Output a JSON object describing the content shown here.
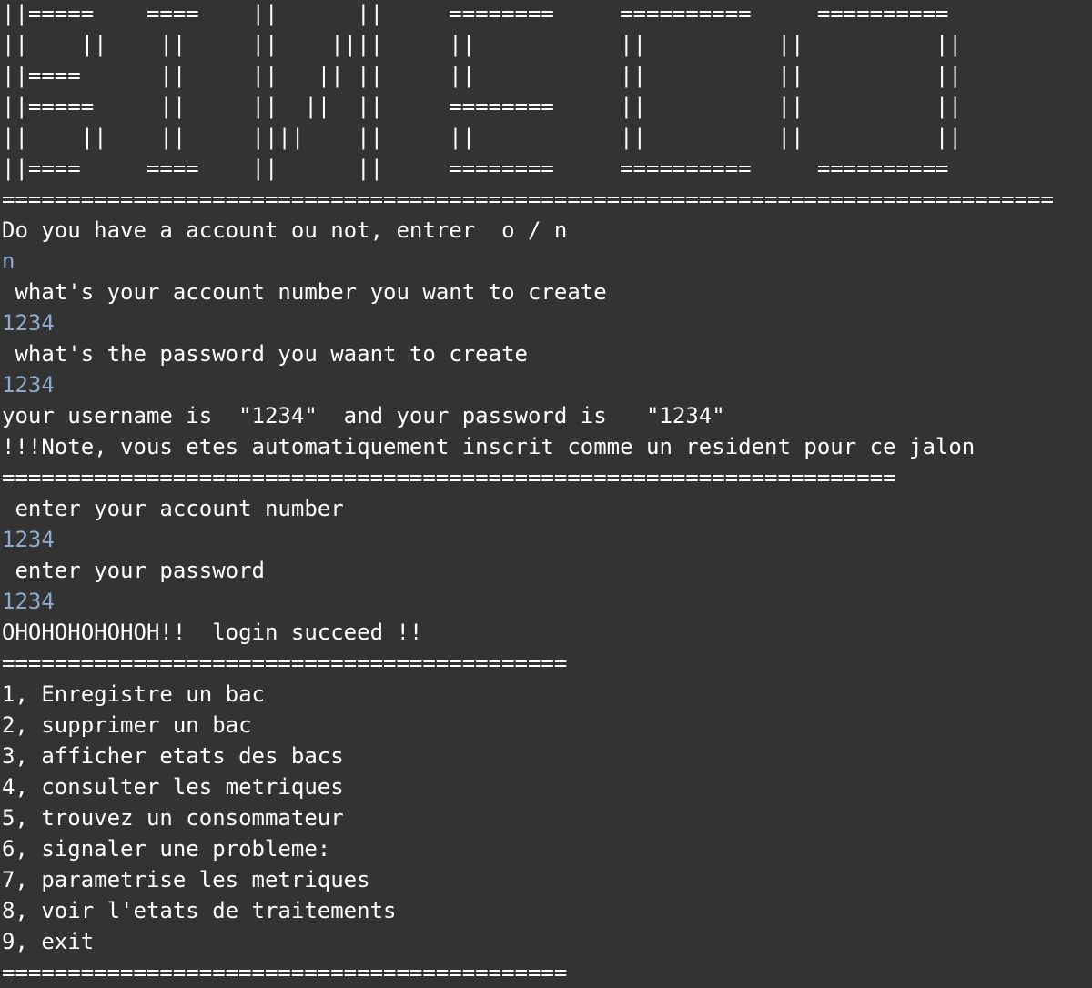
{
  "terminal": {
    "banner": [
      "||=====    ====    ||      ||     ========     ==========     ==========",
      "||    ||    ||     ||    ||||     ||           ||          ||          ||",
      "||====      ||     ||   || ||     ||           ||          ||          ||",
      "||=====     ||     ||  ||  ||     ========     ||          ||          ||",
      "||    ||    ||     ||||    ||     ||           ||          ||          ||",
      "||====     ====    ||      ||     ========     ==========     ==========",
      "================================================================================"
    ],
    "session": [
      {
        "text": "Do you have a account ou not, entrer  o / n",
        "type": "output"
      },
      {
        "text": "n",
        "type": "input"
      },
      {
        "text": " what's your account number you want to create",
        "type": "output"
      },
      {
        "text": "1234",
        "type": "input"
      },
      {
        "text": " what's the password you waant to create",
        "type": "output"
      },
      {
        "text": "1234",
        "type": "input"
      },
      {
        "text": "your username is  \"1234\"  and your password is   \"1234\"",
        "type": "output"
      },
      {
        "text": "!!!Note, vous etes automatiquement inscrit comme un resident pour ce jalon",
        "type": "output"
      },
      {
        "text": "====================================================================",
        "type": "output"
      },
      {
        "text": " enter your account number",
        "type": "output"
      },
      {
        "text": "1234",
        "type": "input"
      },
      {
        "text": " enter your password",
        "type": "output"
      },
      {
        "text": "1234",
        "type": "input"
      },
      {
        "text": "OHOHOHOHOHOH!!  login succeed !!",
        "type": "output"
      },
      {
        "text": "===========================================",
        "type": "output"
      },
      {
        "text": "1, Enregistre un bac",
        "type": "output"
      },
      {
        "text": "2, supprimer un bac",
        "type": "output"
      },
      {
        "text": "3, afficher etats des bacs",
        "type": "output"
      },
      {
        "text": "4, consulter les metriques",
        "type": "output"
      },
      {
        "text": "5, trouvez un consommateur",
        "type": "output"
      },
      {
        "text": "6, signaler une probleme:",
        "type": "output"
      },
      {
        "text": "7, parametrise les metriques",
        "type": "output"
      },
      {
        "text": "8, voir l'etats de traitements",
        "type": "output"
      },
      {
        "text": "9, exit",
        "type": "output"
      },
      {
        "text": "===========================================",
        "type": "output"
      }
    ],
    "colors": {
      "background": "#333333",
      "output_text": "#ffffff",
      "input_text": "#8fa9cc"
    }
  }
}
